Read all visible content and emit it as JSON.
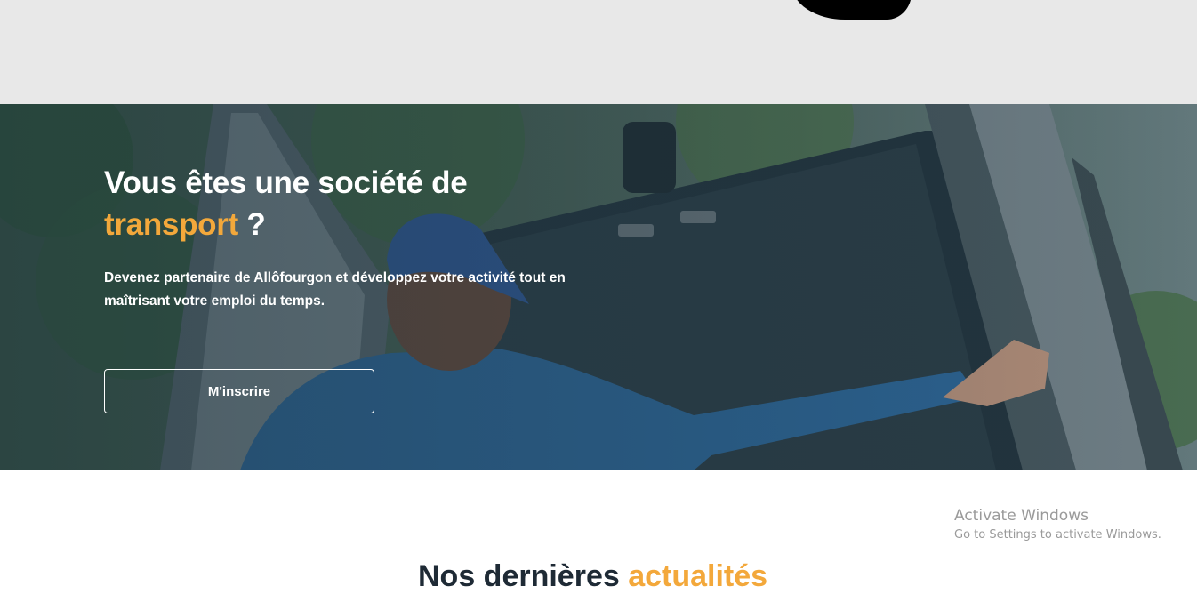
{
  "hero": {
    "title_part1": "Vous êtes une société de",
    "title_accent": "transport",
    "title_suffix": " ?",
    "description": "Devenez partenaire de Allôfourgon et développez votre activité tout en maîtrisant votre emploi du temps.",
    "cta_label": "M'inscrire"
  },
  "next_section": {
    "heading_part1": "Nos dernières ",
    "heading_accent": "actualités"
  },
  "watermark": {
    "title": "Activate Windows",
    "subtitle": "Go to Settings to activate Windows."
  },
  "colors": {
    "accent": "#f3a83b",
    "top_band": "#e8e8e8",
    "hero_overlay": "#2c3e48"
  }
}
